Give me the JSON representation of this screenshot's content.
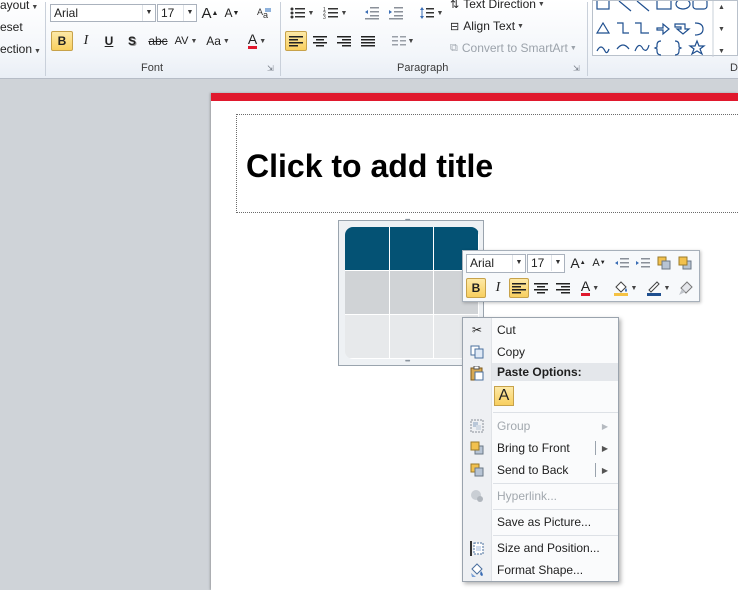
{
  "ribbon": {
    "left_menu": [
      "ayout",
      "eset",
      "ection"
    ],
    "font": {
      "name": "Arial",
      "size": "17",
      "group_label": "Font",
      "grow_label": "A",
      "shrink_label": "A",
      "bold": "B",
      "italic": "I",
      "underline": "U",
      "shadow": "S",
      "strikethrough": "abc",
      "spacing": "AV",
      "change_case": "Aa",
      "font_color": "A"
    },
    "paragraph": {
      "group_label": "Paragraph",
      "text_direction": "Text Direction",
      "align_text": "Align Text",
      "convert_smartart": "Convert to SmartArt"
    },
    "drawing": {
      "group_label_partial": "D"
    }
  },
  "slide": {
    "title_placeholder": "Click to add title",
    "accent_color": "#e0182d",
    "table_header_color": "#045274"
  },
  "mini_toolbar": {
    "font_name": "Arial",
    "font_size": "17",
    "bold": "B",
    "italic": "I",
    "font_color": "A"
  },
  "context_menu": {
    "items": {
      "cut": "Cut",
      "copy": "Copy",
      "paste_options": "Paste Options:",
      "paste_keep_text": "A",
      "group": "Group",
      "bring_to_front": "Bring to Front",
      "send_to_back": "Send to Back",
      "hyperlink": "Hyperlink...",
      "save_as_picture": "Save as Picture...",
      "size_and_position": "Size and Position...",
      "format_shape": "Format Shape..."
    }
  }
}
